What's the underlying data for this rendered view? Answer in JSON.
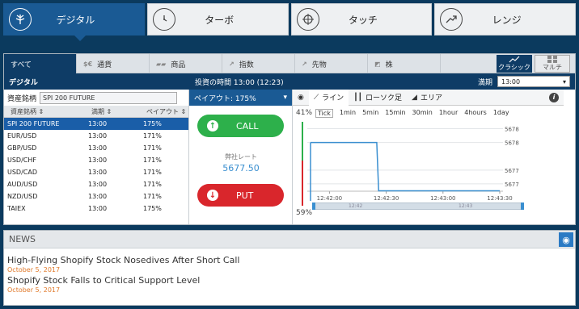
{
  "modes": [
    {
      "label": "デジタル",
      "icon": "tree-icon",
      "active": true
    },
    {
      "label": "ターボ",
      "icon": "clock-icon",
      "active": false
    },
    {
      "label": "タッチ",
      "icon": "target-icon",
      "active": false
    },
    {
      "label": "レンジ",
      "icon": "trend-arrow-icon",
      "active": false
    }
  ],
  "categories": [
    {
      "label": "すべて",
      "icon": "",
      "active": true
    },
    {
      "label": "通貨",
      "icon": "$€",
      "active": false
    },
    {
      "label": "商品",
      "icon": "▰▰",
      "active": false
    },
    {
      "label": "指数",
      "icon": "↗",
      "active": false
    },
    {
      "label": "先物",
      "icon": "↗",
      "active": false
    },
    {
      "label": "株",
      "icon": "◩",
      "active": false
    }
  ],
  "view_modes": {
    "classic": "クラシック",
    "multi": "マルチ"
  },
  "bar": {
    "title": "デジタル",
    "investment_time": "投資の時間 13:00 (12:23)",
    "expiry_label": "満期",
    "expiry_value": "13:00"
  },
  "assets": {
    "filter_label": "資産銘柄",
    "filter_value": "SPI 200 FUTURE",
    "headers": [
      "資産銘柄",
      "満期",
      "ペイアウト"
    ],
    "rows": [
      [
        "SPI 200 FUTURE",
        "13:00",
        "175%"
      ],
      [
        "EUR/USD",
        "13:00",
        "171%"
      ],
      [
        "GBP/USD",
        "13:00",
        "171%"
      ],
      [
        "USD/CHF",
        "13:00",
        "171%"
      ],
      [
        "USD/CAD",
        "13:00",
        "171%"
      ],
      [
        "AUD/USD",
        "13:00",
        "171%"
      ],
      [
        "NZD/USD",
        "13:00",
        "171%"
      ],
      [
        "TAIEX",
        "13:00",
        "175%"
      ]
    ],
    "selected_index": 0
  },
  "trade": {
    "payout": "ペイアウト:  175%",
    "call": "CALL",
    "put": "PUT",
    "rate_label": "弊社レート",
    "rate_value": "5677.50"
  },
  "chart": {
    "tabs": [
      "ライン",
      "ローソク足",
      "エリア"
    ],
    "intervals": [
      "Tick",
      "1min",
      "5min",
      "15min",
      "30min",
      "1hour",
      "4hours",
      "1day"
    ],
    "call_pct": "41%",
    "put_pct": "59%",
    "navigator_labels": [
      "12:42",
      "12:43"
    ]
  },
  "chart_data": {
    "type": "line",
    "x": [
      "12:41:50",
      "12:42:00",
      "12:42:10",
      "12:42:20",
      "12:42:25",
      "12:42:26",
      "12:42:30",
      "12:42:40",
      "12:42:50",
      "12:43:00",
      "12:43:10",
      "12:43:20",
      "12:43:30"
    ],
    "values": [
      5678.2,
      5678.2,
      5678.2,
      5678.2,
      5678.2,
      5677.5,
      5677.5,
      5677.5,
      5677.5,
      5677.5,
      5677.5,
      5677.5,
      5677.5
    ],
    "yticks": [
      "5678.40",
      "5678.20",
      "5677.80",
      "5677.60"
    ],
    "xticks": [
      "12:42:00",
      "12:42:30",
      "12:43:00",
      "12:43:30"
    ],
    "ylim": [
      5677.4,
      5678.5
    ],
    "title": "",
    "xlabel": "",
    "ylabel": ""
  },
  "news": {
    "header": "NEWS",
    "items": [
      {
        "title": "High-Flying Shopify Stock Nosedives After Short Call",
        "date": "October 5, 2017"
      },
      {
        "title": "Shopify Stock Falls to Critical Support Level",
        "date": "October 5, 2017"
      }
    ]
  },
  "colors": {
    "primary": "#1a5a94",
    "dark": "#0e3c66",
    "call": "#2db04b",
    "put": "#d9262c",
    "date": "#e07a2c"
  }
}
